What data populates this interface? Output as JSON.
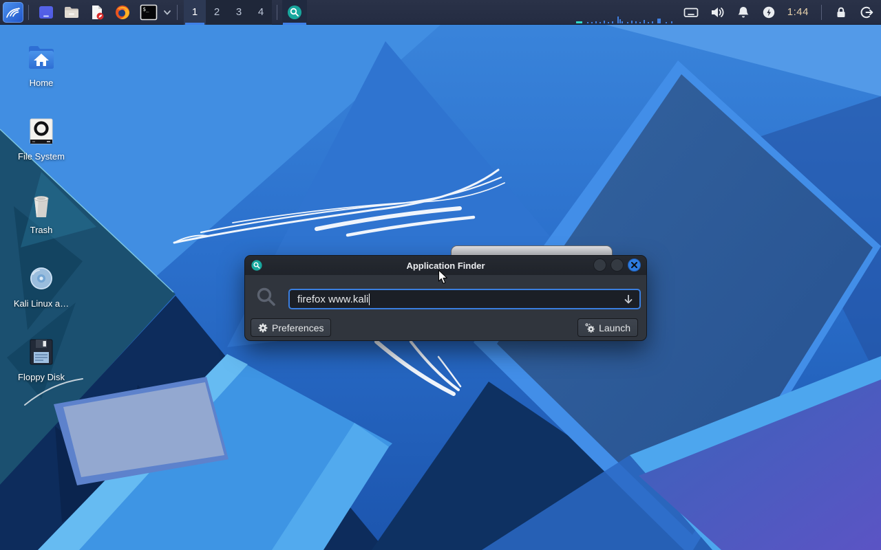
{
  "panel": {
    "menu": {
      "icon": "kali-dragon-logo"
    },
    "launchers": [
      {
        "icon": "screen-window-icon"
      },
      {
        "icon": "file-manager-folder-icon"
      },
      {
        "icon": "text-editor-document-icon"
      },
      {
        "icon": "firefox-icon"
      },
      {
        "icon": "terminal-icon"
      }
    ],
    "terminal_glyph": "$_",
    "workspaces": [
      {
        "label": "1",
        "active": true
      },
      {
        "label": "2",
        "active": false
      },
      {
        "label": "3",
        "active": false
      },
      {
        "label": "4",
        "active": false
      }
    ],
    "taskbar": [
      {
        "name": "Application Finder",
        "icon": "magnifier-teal",
        "active": true
      }
    ],
    "clock": "1:44",
    "tray": [
      "keyboard",
      "volume",
      "notifications",
      "power-manager",
      "clock",
      "lock-screen",
      "log-out"
    ]
  },
  "desktop": {
    "icons": [
      {
        "label": "Home"
      },
      {
        "label": "File System"
      },
      {
        "label": "Trash"
      },
      {
        "label": "Kali Linux a…"
      },
      {
        "label": "Floppy Disk"
      }
    ]
  },
  "dialog": {
    "title": "Application Finder",
    "window_buttons": [
      "minimize",
      "maximize",
      "close"
    ],
    "search": {
      "value": "firefox www.kali",
      "icon": "magnifier",
      "dropdown_icon": "arrow-down"
    },
    "buttons": {
      "preferences": "Preferences",
      "launch": "Launch"
    }
  },
  "colors": {
    "accent_blue": "#3f80e8",
    "input_border": "#3a7fe0",
    "close_button": "#2e7ce0",
    "finder_teal": "#18a89e",
    "clock_text": "#e8d2ac",
    "panel_bg": "#262e44",
    "dialog_bg": "#30353d"
  }
}
